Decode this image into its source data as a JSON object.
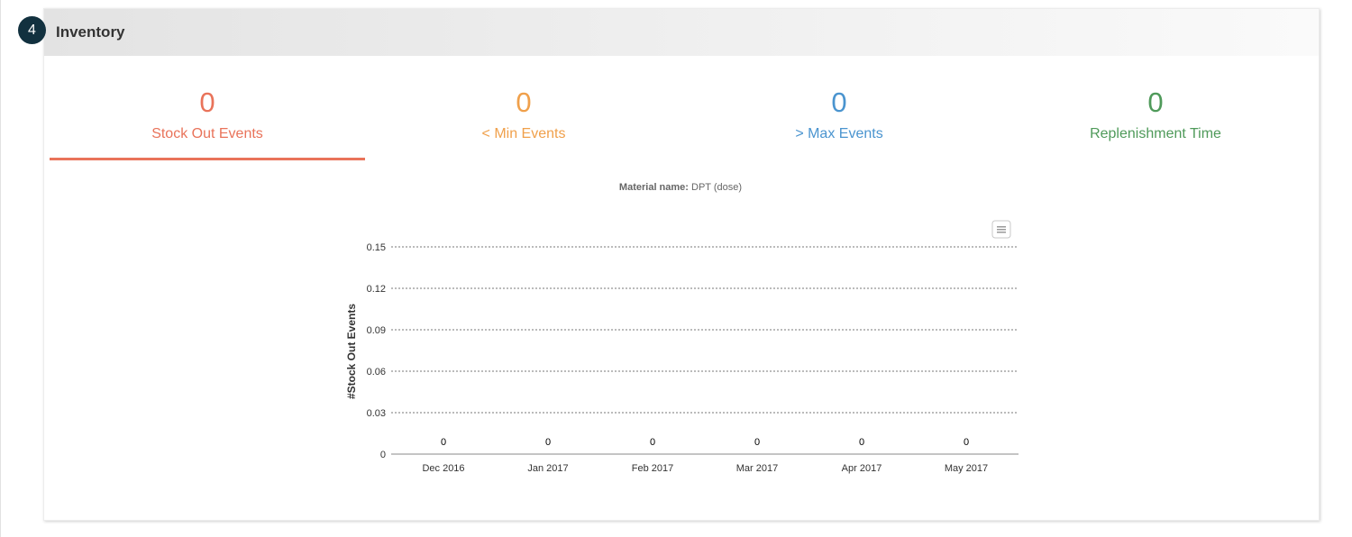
{
  "badge": "4",
  "panel_title": "Inventory",
  "tabs": [
    {
      "value": "0",
      "label": "Stock Out Events",
      "color": "#e9735a",
      "active": true
    },
    {
      "value": "0",
      "label": "< Min Events",
      "color": "#f0a04b",
      "active": false
    },
    {
      "value": "0",
      "label": "> Max Events",
      "color": "#4a94cf",
      "active": false
    },
    {
      "value": "0",
      "label": "Replenishment Time",
      "color": "#4f9a5a",
      "active": false
    }
  ],
  "material": {
    "label": "Material name:",
    "value": "DPT (dose)"
  },
  "menu_icon": "hamburger-menu-icon",
  "chart_data": {
    "type": "bar",
    "categories": [
      "Dec 2016",
      "Jan 2017",
      "Feb 2017",
      "Mar 2017",
      "Apr 2017",
      "May 2017"
    ],
    "values": [
      0,
      0,
      0,
      0,
      0,
      0
    ],
    "data_labels": [
      "0",
      "0",
      "0",
      "0",
      "0",
      "0"
    ],
    "ylabel": "#Stock Out Events",
    "ylim": [
      0,
      0.15
    ],
    "yticks": [
      0,
      0.03,
      0.06,
      0.09,
      0.12,
      0.15
    ],
    "ytick_labels": [
      "0",
      "0.03",
      "0.06",
      "0.09",
      "0.12",
      "0.15"
    ],
    "grid": true,
    "grid_style": "dashed",
    "bar_color": "#e9735a"
  }
}
